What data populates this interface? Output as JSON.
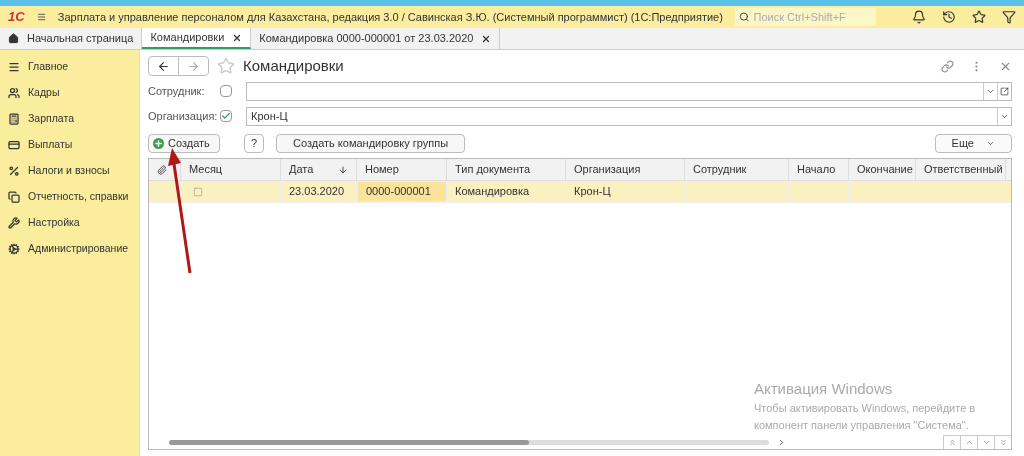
{
  "app_bar": {
    "logo": "1С",
    "title": "Зарплата и управление персоналом для Казахстана, редакция 3.0 / Савинская З.Ю. (Системный программист)  (1С:Предприятие)",
    "search": {
      "placeholder": "Поиск Ctrl+Shift+F"
    }
  },
  "tabs": [
    {
      "label": "Начальная страница",
      "kind": "home",
      "selected": false
    },
    {
      "label": "Командировки",
      "kind": "closable",
      "selected": true
    },
    {
      "label": "Командировка 0000-000001 от 23.03.2020",
      "kind": "closable",
      "selected": false
    }
  ],
  "sidebar": {
    "items": [
      {
        "label": "Главное"
      },
      {
        "label": "Кадры"
      },
      {
        "label": "Зарплата"
      },
      {
        "label": "Выплаты"
      },
      {
        "label": "Налоги и взносы"
      },
      {
        "label": "Отчетность, справки"
      },
      {
        "label": "Настройка"
      },
      {
        "label": "Администрирование"
      }
    ]
  },
  "form": {
    "title": "Командировки",
    "filters": [
      {
        "label": "Сотрудник:",
        "checked": false,
        "open_button": true
      },
      {
        "label": "Организация:",
        "checked": true,
        "value": "Крон-Ц",
        "open_button": false
      }
    ],
    "buttons": {
      "create": "Создать",
      "help": "?",
      "group": "Создать командировку группы",
      "more": "Еще"
    },
    "table": {
      "columns": [
        {
          "kind": "attach"
        },
        {
          "label": "Месяц"
        },
        {
          "label": "Дата",
          "sorted": true
        },
        {
          "label": "Номер"
        },
        {
          "label": "Тип документа"
        },
        {
          "label": "Организация"
        },
        {
          "label": "Сотрудник"
        },
        {
          "label": "Начало"
        },
        {
          "label": "Окончание"
        },
        {
          "label": "Ответственный"
        }
      ],
      "rows": [
        {
          "selected": true,
          "cells": [
            "",
            "",
            "23.03.2020",
            "0000-000001",
            "Командировка",
            "Крон-Ц",
            "",
            "",
            "",
            ""
          ]
        }
      ]
    }
  },
  "overlay": {
    "title": "Активация Windows",
    "text": "Чтобы активировать Windows, перейдите в компонент панели управления \"Система\"."
  }
}
